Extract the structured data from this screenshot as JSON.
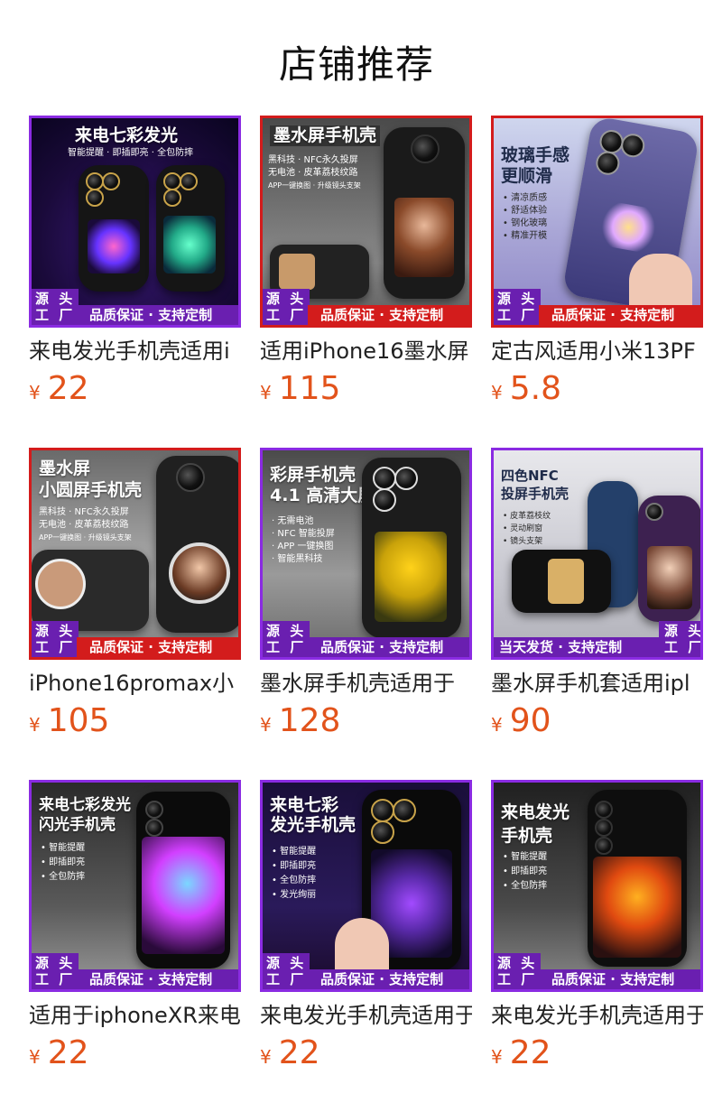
{
  "header": {
    "title": "店铺推荐"
  },
  "products": [
    {
      "headline": "来电七彩发光",
      "sub": [
        "智能提醒 · 即插即亮 · 全包防摔"
      ],
      "source": "源 头\n工 厂",
      "bar": "品质保证 · 支持定制",
      "name": "来电发光手机壳适用i",
      "currency": "¥",
      "price": "22",
      "theme": "purple"
    },
    {
      "headline": "墨水屏手机壳",
      "sub": [
        "黑科技 · NFC永久投屏",
        "无电池 · 皮革荔枝纹路",
        "APP一键换图 · 升级镜头支架"
      ],
      "source": "源 头\n工 厂",
      "bar": "品质保证 · 支持定制",
      "name": "适用iPhone16墨水屏",
      "currency": "¥",
      "price": "115",
      "theme": "red"
    },
    {
      "headline": "玻璃手感\n更顺滑",
      "sub": [
        "• 清凉质感",
        "• 舒适体验",
        "• 钢化玻璃",
        "• 精准开模"
      ],
      "source": "源 头\n工 厂",
      "bar": "品质保证 · 支持定制",
      "name": "定古风适用小米13PF",
      "currency": "¥",
      "price": "5.8",
      "theme": "red"
    },
    {
      "headline": "墨水屏\n小圆屏手机壳",
      "sub": [
        "黑科技 · NFC永久投屏",
        "无电池 · 皮革荔枝纹路",
        "APP一键换图 · 升级镜头支架"
      ],
      "source": "源 头\n工 厂",
      "bar": "品质保证 · 支持定制",
      "name": "iPhone16promax小",
      "currency": "¥",
      "price": "105",
      "theme": "red"
    },
    {
      "headline": "彩屏手机壳\n4.1 高清大屏",
      "sub": [
        "· 无需电池",
        "· NFC 智能投屏",
        "· APP 一键换图",
        "· 智能黑科技"
      ],
      "source": "源 头\n工 厂",
      "bar": "品质保证 · 支持定制",
      "name": "墨水屏手机壳适用于",
      "currency": "¥",
      "price": "128",
      "theme": "purple"
    },
    {
      "headline": "四色NFC\n投屏手机壳",
      "sub": [
        "• 皮革荔枝纹",
        "• 灵动刷窗",
        "• 镜头支架"
      ],
      "source": "源 头\n工 厂",
      "bar": "当天发货 · 支持定制",
      "name": "墨水屏手机套适用ipl",
      "currency": "¥",
      "price": "90",
      "theme": "purple"
    },
    {
      "headline": "来电七彩发光\n闪光手机壳",
      "sub": [
        "• 智能提醒",
        "• 即插即亮",
        "• 全包防摔"
      ],
      "source": "源 头\n工 厂",
      "bar": "品质保证 · 支持定制",
      "name": "适用于iphoneXR来电",
      "currency": "¥",
      "price": "22",
      "theme": "purple"
    },
    {
      "headline": "来电七彩\n发光手机壳",
      "sub": [
        "• 智能提醒",
        "• 即插即亮",
        "• 全包防摔",
        "• 发光绚丽"
      ],
      "source": "源 头\n工 厂",
      "bar": "品质保证 · 支持定制",
      "name": "来电发光手机壳适用于",
      "currency": "¥",
      "price": "22",
      "theme": "purple"
    },
    {
      "headline": "来电发光\n手机壳",
      "sub": [
        "• 智能提醒",
        "• 即插即亮",
        "• 全包防摔"
      ],
      "source": "源 头\n工 厂",
      "bar": "品质保证 · 支持定制",
      "name": "来电发光手机壳适用于",
      "currency": "¥",
      "price": "22",
      "theme": "purple"
    }
  ],
  "colors": {
    "price": "#e2531b",
    "purple": "#6a1fb0",
    "red": "#d31c1c"
  }
}
